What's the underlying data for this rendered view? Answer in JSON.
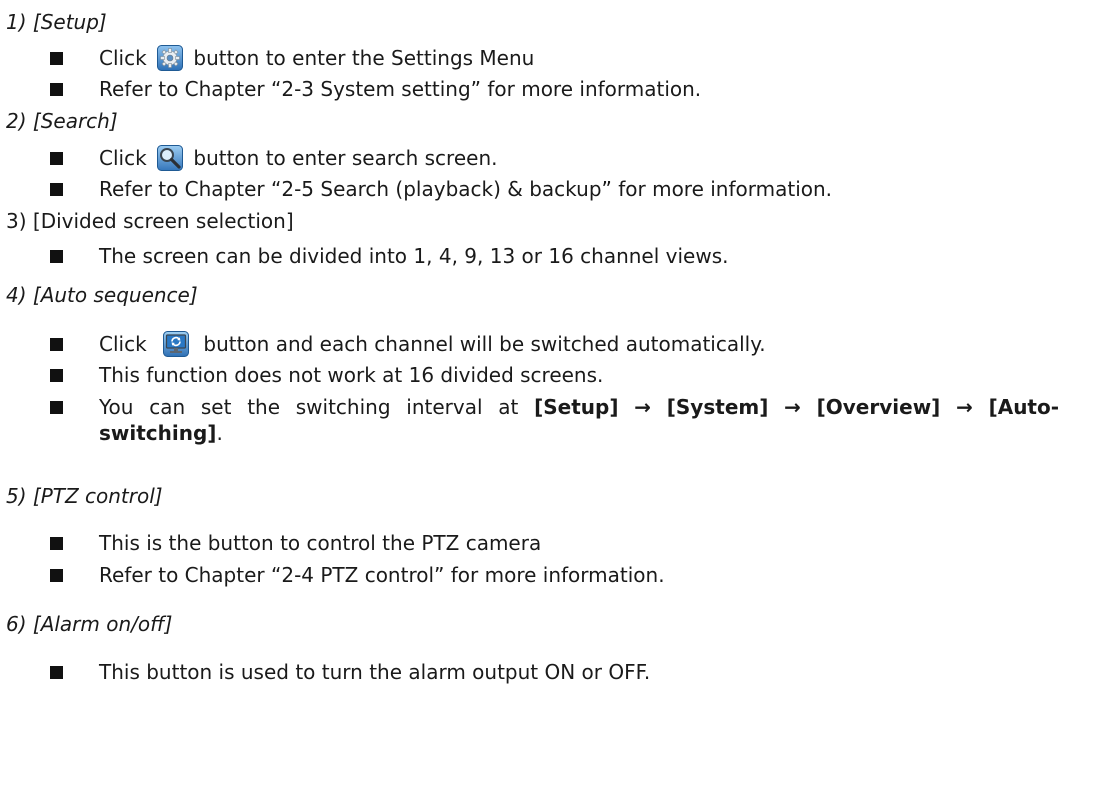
{
  "sections": [
    {
      "heading": "1) [Setup]",
      "bullets": [
        {
          "pre": "Click",
          "icon": "gear-icon",
          "post": "button to enter the Settings Menu"
        },
        {
          "text": "Refer to Chapter “2-3 System setting” for more information."
        }
      ]
    },
    {
      "heading": "2) [Search]",
      "bullets": [
        {
          "pre": "Click",
          "icon": "magnifier-icon",
          "post": "button to enter search screen."
        },
        {
          "text": "Refer to Chapter “2-5 Search (playback) & backup” for more information."
        }
      ]
    },
    {
      "heading": "3) [Divided screen selection]",
      "bullets": [
        {
          "text": "The screen can be divided into 1, 4, 9, 13 or 16 channel views."
        }
      ]
    },
    {
      "heading": "4) [Auto sequence]",
      "bullets": [
        {
          "pre": "Click",
          "icon": "monitor-refresh-icon",
          "post": "button and each channel will be switched automatically."
        },
        {
          "text": "This function does not work at 16 divided screens."
        },
        {
          "pre": "You can set the switching interval at",
          "path": [
            "[Setup]",
            "[System]",
            "[Overview]",
            "[Auto-switching]"
          ],
          "arrow": "→",
          "end": "."
        }
      ]
    },
    {
      "heading": "5) [PTZ control]",
      "bullets": [
        {
          "text": "This is the button to control the PTZ camera"
        },
        {
          "text": "Refer to Chapter “2-4 PTZ control” for more information."
        }
      ]
    },
    {
      "heading": "6) [Alarm on/off]",
      "bullets": [
        {
          "text": "This button is used to turn the alarm output ON or OFF."
        }
      ]
    }
  ]
}
